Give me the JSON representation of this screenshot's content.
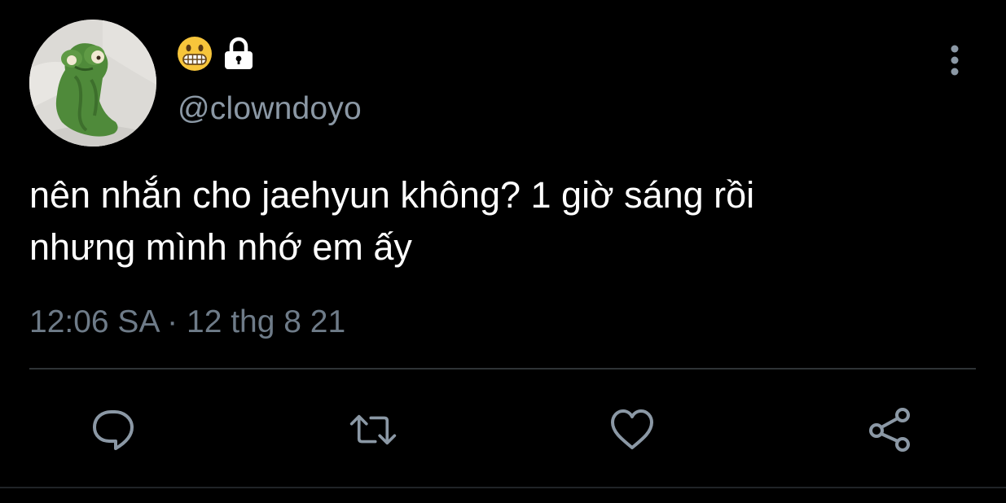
{
  "author": {
    "display_name_icons": [
      "grimacing-face-emoji",
      "lock-icon"
    ],
    "handle": "@clowndoyo",
    "avatar": "kermit-frog-avatar"
  },
  "tweet": {
    "text_lines": [
      "nên nhắn cho jaehyun không? 1 giờ sáng rồi",
      "nhưng mình nhớ em ấy"
    ],
    "time": "12:06 SA",
    "separator": "·",
    "date": "12 thg 8 21"
  },
  "actions": [
    {
      "name": "reply",
      "icon": "comment-icon"
    },
    {
      "name": "retweet",
      "icon": "retweet-icon"
    },
    {
      "name": "like",
      "icon": "heart-icon"
    },
    {
      "name": "share",
      "icon": "share-icon"
    }
  ],
  "colors": {
    "background": "#000000",
    "text": "#ffffff",
    "secondary": "#8b98a5",
    "divider": "#2f3336",
    "icon": "#8b98a5"
  }
}
